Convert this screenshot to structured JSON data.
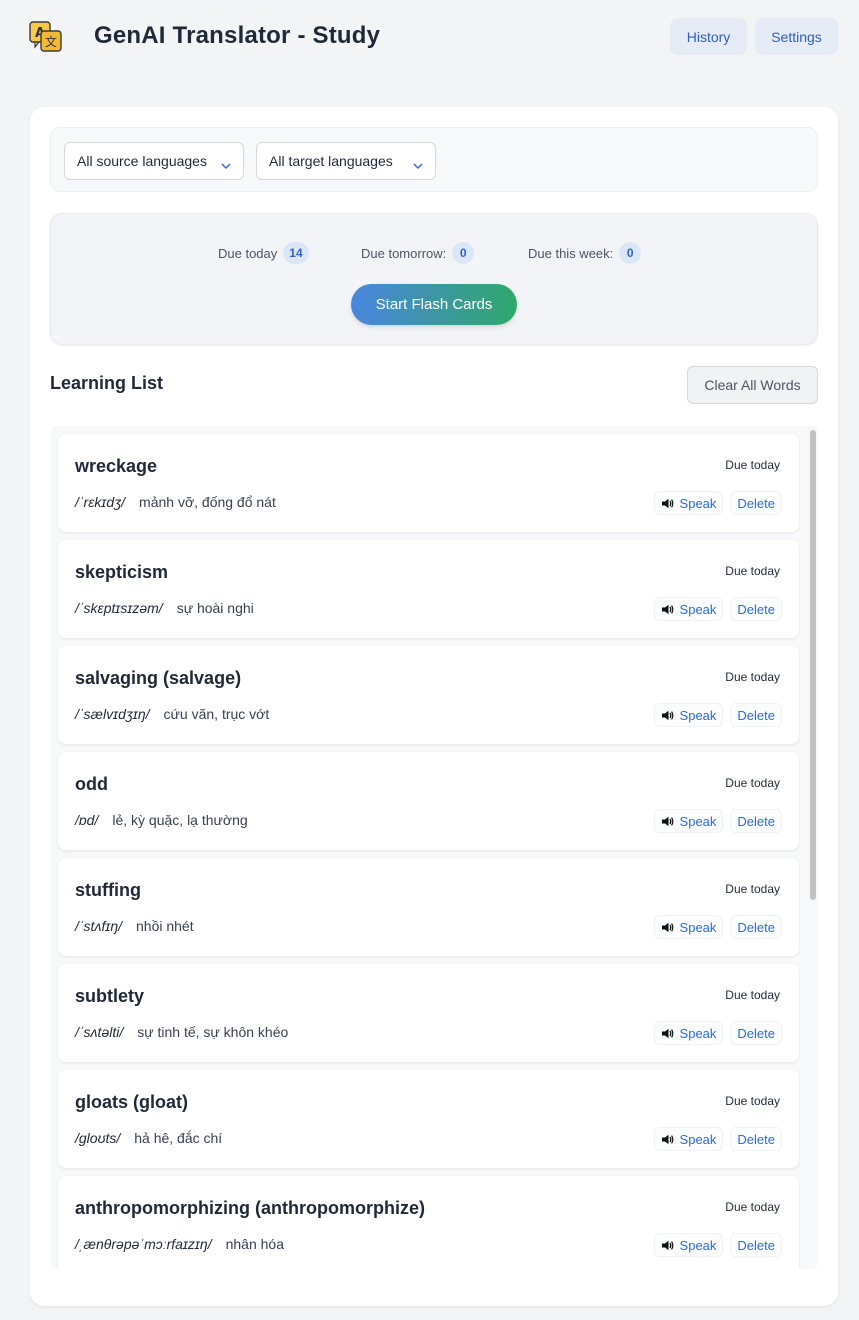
{
  "header": {
    "title": "GenAI Translator - Study",
    "history_label": "History",
    "settings_label": "Settings",
    "logo_icon": "translate-icon"
  },
  "filters": {
    "source": "All source languages",
    "target": "All target languages"
  },
  "stats": {
    "today_label": "Due today",
    "today_count": "14",
    "tomorrow_label": "Due tomorrow:",
    "tomorrow_count": "0",
    "week_label": "Due this week:",
    "week_count": "0",
    "start_label": "Start Flash Cards"
  },
  "list": {
    "title": "Learning List",
    "clear_label": "Clear All Words",
    "speak_label": "Speak",
    "delete_label": "Delete",
    "items": [
      {
        "word": "wreckage",
        "ipa": "/ˈrɛkɪdʒ/",
        "meaning": "mảnh vỡ, đống đổ nát",
        "due": "Due today"
      },
      {
        "word": "skepticism",
        "ipa": "/ˈskɛptɪsɪzəm/",
        "meaning": "sự hoài nghi",
        "due": "Due today"
      },
      {
        "word": "salvaging (salvage)",
        "ipa": "/ˈsælvɪdʒɪŋ/",
        "meaning": "cứu vãn, trục vớt",
        "due": "Due today"
      },
      {
        "word": "odd",
        "ipa": "/ɒd/",
        "meaning": "lẻ, kỳ quặc, lạ thường",
        "due": "Due today"
      },
      {
        "word": "stuffing",
        "ipa": "/ˈstʌfɪŋ/",
        "meaning": "nhồi nhét",
        "due": "Due today"
      },
      {
        "word": "subtlety",
        "ipa": "/ˈsʌtəlti/",
        "meaning": "sự tinh tế, sự khôn khéo",
        "due": "Due today"
      },
      {
        "word": "gloats (gloat)",
        "ipa": "/gloʊts/",
        "meaning": "hả hê, đắc chí",
        "due": "Due today"
      },
      {
        "word": "anthropomorphizing (anthropomorphize)",
        "ipa": "/ˌænθrəpəˈmɔːrfaɪzɪŋ/",
        "meaning": "nhân hóa",
        "due": "Due today"
      }
    ]
  },
  "colors": {
    "accent": "#2e6bd0",
    "gradient_start": "#4a86e0",
    "gradient_end": "#2fa86a",
    "badge_bg": "#dbe7f7"
  }
}
